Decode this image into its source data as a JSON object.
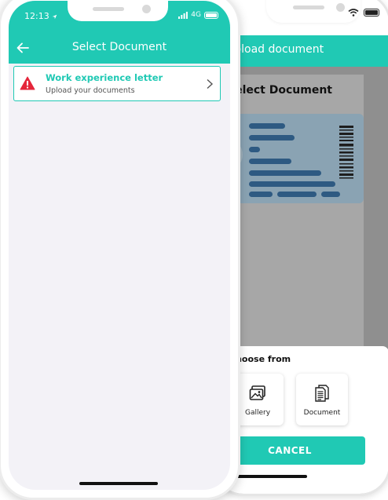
{
  "back_phone": {
    "appbar_title": "Upload document",
    "card_title": "Select Document",
    "sheet": {
      "title": "Choose from",
      "options": [
        {
          "label": "Gallery",
          "icon": "gallery-icon"
        },
        {
          "label": "Document",
          "icon": "document-icon"
        }
      ],
      "cancel_label": "CANCEL"
    }
  },
  "front_phone": {
    "status": {
      "time": "12:13",
      "network": "4G"
    },
    "appbar_title": "Select Document",
    "documents": [
      {
        "title": "Work experience letter",
        "subtitle": "Upload your documents",
        "status_icon": "warning-icon"
      }
    ]
  },
  "colors": {
    "accent": "#20c9b4",
    "warning": "#e5263b",
    "overlay": "#8f8f8f"
  }
}
